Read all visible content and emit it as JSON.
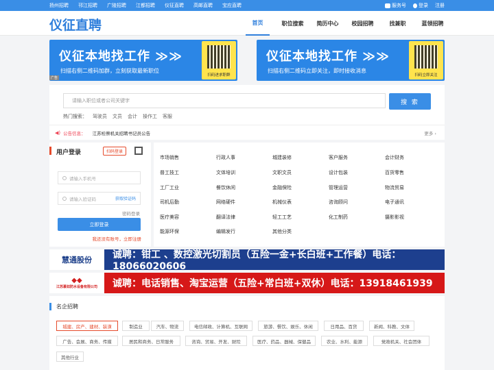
{
  "topbar": {
    "cities": [
      "扬州招聘",
      "邗江招聘",
      "广陵招聘",
      "江都招聘",
      "仪征直聘",
      "高邮直聘",
      "宝应直聘"
    ],
    "service": "服务号",
    "login": "登录",
    "register": "注册"
  },
  "header": {
    "logo": "仪征直聘",
    "nav": [
      "首页",
      "职位搜索",
      "简历中心",
      "校园招聘",
      "找兼职",
      "蓝领招聘"
    ]
  },
  "banners": [
    {
      "title": "仪征本地找工作 ≫≫",
      "sub": "扫描右侧二维码加群，立刻获取最新职位",
      "qr_caption": "扫码进求职群"
    },
    {
      "title": "仪征本地找工作 ≫≫",
      "sub": "扫描右侧二维码立即关注，即时接收消息",
      "qr_caption": "扫码立即关注"
    }
  ],
  "ad_tag": "广告",
  "search": {
    "placeholder": "请输入职位或者公司关键字",
    "button": "搜 索",
    "hot_label": "热门搜索：",
    "hot": [
      "驾驶员",
      "文员",
      "会计",
      "操作工",
      "客服"
    ]
  },
  "notice": {
    "label": "公告信息：",
    "text": "江苏检察机关招聘书记员公告",
    "more": "更多 ›"
  },
  "login": {
    "title": "用户登录",
    "scan": "扫码登录",
    "phone_placeholder": "请输入手机号",
    "code_placeholder": "请输入验证码",
    "get_code": "获取验证码",
    "password": "密码登录",
    "submit": "立即登录",
    "register": "我还没有账号，立即注册"
  },
  "categories": [
    [
      "市场销售",
      "行政人事",
      "城建装修",
      "客户服务",
      "会计财务"
    ],
    [
      "普工技工",
      "文体培训",
      "文职文员",
      "设计包装",
      "百货零售"
    ],
    [
      "工厂工业",
      "餐饮休闲",
      "金融保险",
      "管理运营",
      "物流贸易"
    ],
    [
      "司机后勤",
      "网络硬件",
      "机械仪表",
      "咨询顾问",
      "电子通讯"
    ],
    [
      "医疗美容",
      "翻译法律",
      "轻工工艺",
      "化工制药",
      "摄影影视"
    ],
    [
      "能源环保",
      "编辑发行",
      "其他分类"
    ]
  ],
  "ads": [
    {
      "logo": "慧通股份",
      "text": "诚聘：钳工 、数控激光切割员（五险一金+长白班+工作餐）电话：18066020606"
    },
    {
      "logo_small": "江苏慕如防水设备有限公司",
      "text": "诚聘：电话销售、淘宝运营（五险+常白班+双休）电话：13918461939"
    }
  ],
  "famous": {
    "title": "名企招聘",
    "chips": [
      "城建、房产、建材、装潢",
      "制造业",
      "汽车、物流",
      "电信邮政、计算机、互联网",
      "旅游、餐饮、娱乐、休闲",
      "日用品、百货",
      "新闻、科教、文体",
      "广告、会展、商务、传媒",
      "居民和商务、日常服务",
      "咨询、贸易、开发、财险",
      "医疗、药品、器械、保健品",
      "农业、水利、能源",
      "党政机关、社会团体",
      "其他行业"
    ]
  }
}
